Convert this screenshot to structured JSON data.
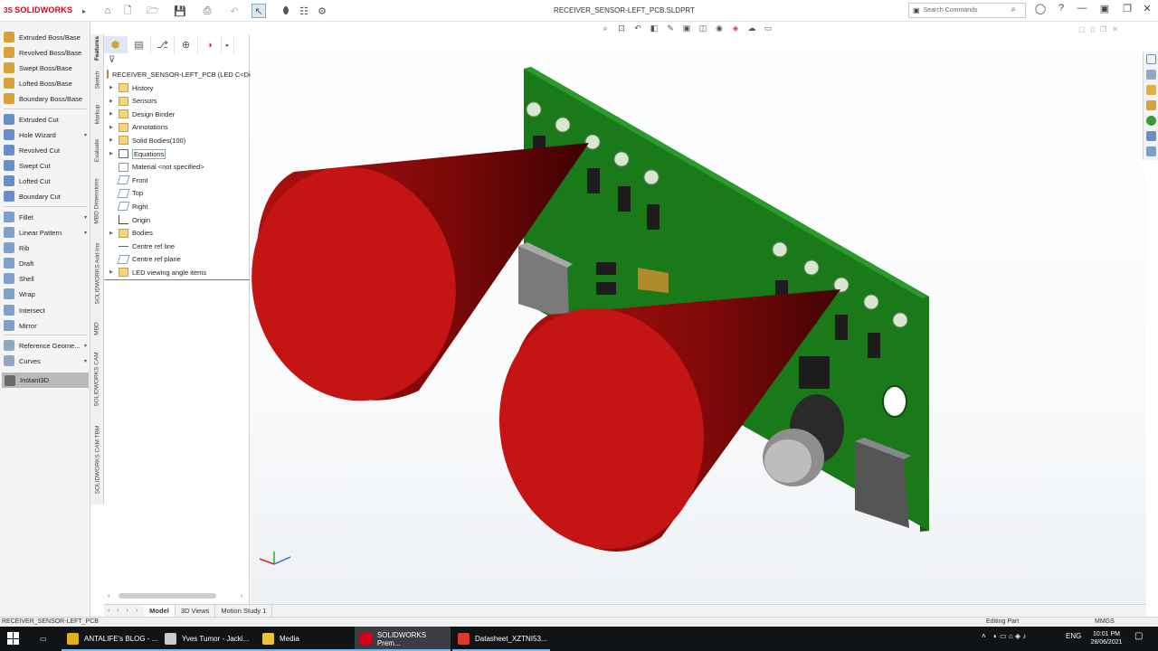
{
  "titlebar": {
    "brand": "SOLIDWORKS",
    "document_title": "RECEIVER_SENSOR-LEFT_PCB.SLDPRT",
    "search_placeholder": "Search Commands"
  },
  "command_manager": {
    "items": [
      {
        "label": "Extruded Boss/Base",
        "color": "#d8a23a"
      },
      {
        "label": "Revolved Boss/Base",
        "color": "#d8a23a"
      },
      {
        "label": "Swept Boss/Base",
        "color": "#d8a23a"
      },
      {
        "label": "Lofted Boss/Base",
        "color": "#d8a23a"
      },
      {
        "label": "Boundary Boss/Base",
        "color": "#d8a23a"
      },
      {
        "label": "Extruded Cut",
        "color": "#6a8fc7"
      },
      {
        "label": "Hole Wizard",
        "color": "#6a8fc7"
      },
      {
        "label": "Revolved Cut",
        "color": "#6a8fc7"
      },
      {
        "label": "Swept Cut",
        "color": "#6a8fc7"
      },
      {
        "label": "Lofted Cut",
        "color": "#6a8fc7"
      },
      {
        "label": "Boundary Cut",
        "color": "#6a8fc7"
      },
      {
        "label": "Fillet",
        "color": "#7fa0c8"
      },
      {
        "label": "Linear Pattern",
        "color": "#7fa0c8"
      },
      {
        "label": "Rib",
        "color": "#7fa0c8"
      },
      {
        "label": "Draft",
        "color": "#7fa0c8"
      },
      {
        "label": "Shell",
        "color": "#7fa0c8"
      },
      {
        "label": "Wrap",
        "color": "#7fa0c8"
      },
      {
        "label": "Intersect",
        "color": "#7fa0c8"
      },
      {
        "label": "Mirror",
        "color": "#7fa0c8"
      },
      {
        "label": "Reference Geome...",
        "color": "#8fa8c0"
      },
      {
        "label": "Curves",
        "color": "#8fa8c0"
      }
    ],
    "instant3d_label": "Instant3D"
  },
  "vertical_tabs": [
    "Features",
    "Sketch",
    "Markup",
    "Evaluate",
    "MBD Dimensions",
    "SOLIDWORKS Add-Ins",
    "MBD",
    "SOLIDWORKS CAM",
    "SOLIDWORKS CAM TBM"
  ],
  "feature_tree": {
    "root": "RECEIVER_SENSOR-LEFT_PCB  (LED C<Di",
    "items": [
      {
        "label": "History",
        "icon": "folder-icon",
        "expandable": true
      },
      {
        "label": "Sensors",
        "icon": "folder-icon",
        "expandable": true
      },
      {
        "label": "Design Binder",
        "icon": "folder-icon",
        "expandable": true
      },
      {
        "label": "Annotations",
        "icon": "folder-icon",
        "expandable": true
      },
      {
        "label": "Solid Bodies(100)",
        "icon": "folder-icon",
        "expandable": true
      },
      {
        "label": "Equations",
        "icon": "sigma-icon",
        "expandable": true
      },
      {
        "label": "Material <not specified>",
        "icon": "material-icon",
        "expandable": false
      },
      {
        "label": "Front",
        "icon": "plane-icon",
        "expandable": false
      },
      {
        "label": "Top",
        "icon": "plane-icon",
        "expandable": false
      },
      {
        "label": "Right",
        "icon": "plane-icon",
        "expandable": false
      },
      {
        "label": "Origin",
        "icon": "origin-icon",
        "expandable": false
      },
      {
        "label": "Bodies",
        "icon": "folder-icon",
        "expandable": true
      },
      {
        "label": "Centre ref line",
        "icon": "line-icon",
        "expandable": false
      },
      {
        "label": "Centre ref plane",
        "icon": "plane-icon",
        "expandable": false
      },
      {
        "label": "LED viewing angle items",
        "icon": "folder-icon",
        "expandable": true
      }
    ]
  },
  "bottom_tabs": [
    "Model",
    "3D Views",
    "Motion Study 1"
  ],
  "status": {
    "left": "RECEIVER_SENSOR-LEFT_PCB",
    "mode": "Editing Part",
    "units": "MMGS"
  },
  "taskbar": {
    "apps": [
      {
        "label": "ANTALIFE's BLOG - ...",
        "color": "#e0b020"
      },
      {
        "label": "Yves Tumor - Jacki...",
        "color": "#cccccc"
      },
      {
        "label": "Media",
        "color": "#e8c23a"
      },
      {
        "label": "SOLIDWORKS Prem...",
        "color": "#d6001c"
      },
      {
        "label": "Datasheet_XZTNI53...",
        "color": "#d93a2a"
      }
    ],
    "lang": "ENG",
    "time": "10:01 PM",
    "date": "28/06/2021"
  }
}
